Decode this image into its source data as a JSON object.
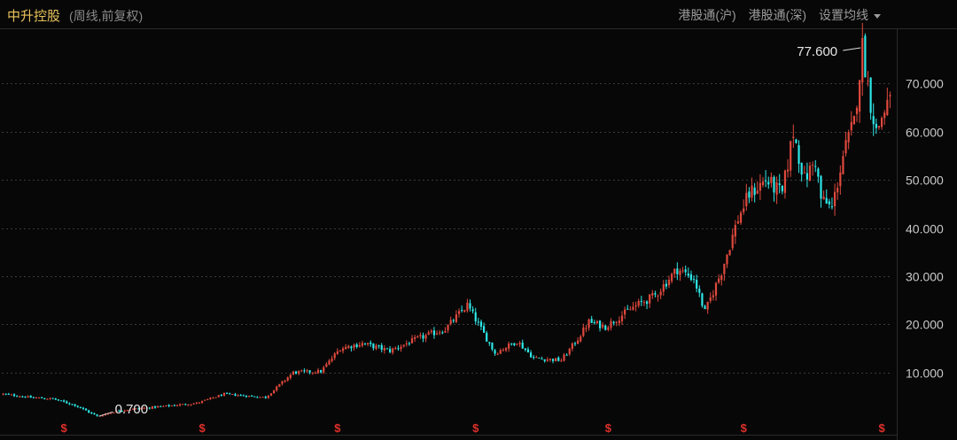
{
  "header": {
    "title": "中升控股",
    "subtitle": "(周线,前复权)",
    "tools": [
      "港股通(沪)",
      "港股通(深)",
      "设置均线"
    ]
  },
  "colors": {
    "up": "#e0493d",
    "down": "#2ee8e8",
    "grid": "#3a3a3a",
    "axis": "#2a2a2a",
    "marker": "#e0302a"
  },
  "dividend_marker": "$",
  "chart_data": {
    "type": "candlestick",
    "ylim": [
      0,
      80
    ],
    "y_ticks": [
      "10.000",
      "20.000",
      "30.000",
      "40.000",
      "50.000",
      "60.000",
      "70.000"
    ],
    "grid": true,
    "annotations": [
      {
        "label": "77.600",
        "index": 311,
        "value": 77.6
      },
      {
        "label": "0.700",
        "index": 34,
        "value": 0.7
      }
    ],
    "dividend_marker_indices": [
      22,
      72,
      121,
      171,
      219,
      268,
      318
    ],
    "price_path": [
      [
        0,
        5.5
      ],
      [
        10,
        4.8
      ],
      [
        18,
        4.5
      ],
      [
        26,
        3.2
      ],
      [
        34,
        0.9
      ],
      [
        42,
        2.1
      ],
      [
        55,
        2.8
      ],
      [
        70,
        3.6
      ],
      [
        80,
        5.5
      ],
      [
        95,
        4.8
      ],
      [
        105,
        10.0
      ],
      [
        115,
        10.2
      ],
      [
        122,
        15.0
      ],
      [
        130,
        16.0
      ],
      [
        140,
        14.5
      ],
      [
        150,
        17.0
      ],
      [
        160,
        19.0
      ],
      [
        168,
        24.0
      ],
      [
        172,
        20.0
      ],
      [
        178,
        14.0
      ],
      [
        186,
        16.5
      ],
      [
        192,
        13.0
      ],
      [
        202,
        12.5
      ],
      [
        208,
        17.0
      ],
      [
        212,
        20.5
      ],
      [
        218,
        19.5
      ],
      [
        228,
        23.5
      ],
      [
        236,
        26.0
      ],
      [
        244,
        31.5
      ],
      [
        250,
        29.5
      ],
      [
        254,
        22.5
      ],
      [
        260,
        31.0
      ],
      [
        266,
        42.0
      ],
      [
        270,
        47.0
      ],
      [
        276,
        50.0
      ],
      [
        282,
        47.0
      ],
      [
        286,
        60.0
      ],
      [
        290,
        50.0
      ],
      [
        294,
        54.0
      ],
      [
        296,
        46.0
      ],
      [
        300,
        44.0
      ],
      [
        304,
        55.0
      ],
      [
        308,
        62.0
      ],
      [
        311,
        77.6
      ],
      [
        314,
        66.0
      ],
      [
        316,
        60.0
      ],
      [
        320,
        66.0
      ]
    ],
    "count": 322
  }
}
